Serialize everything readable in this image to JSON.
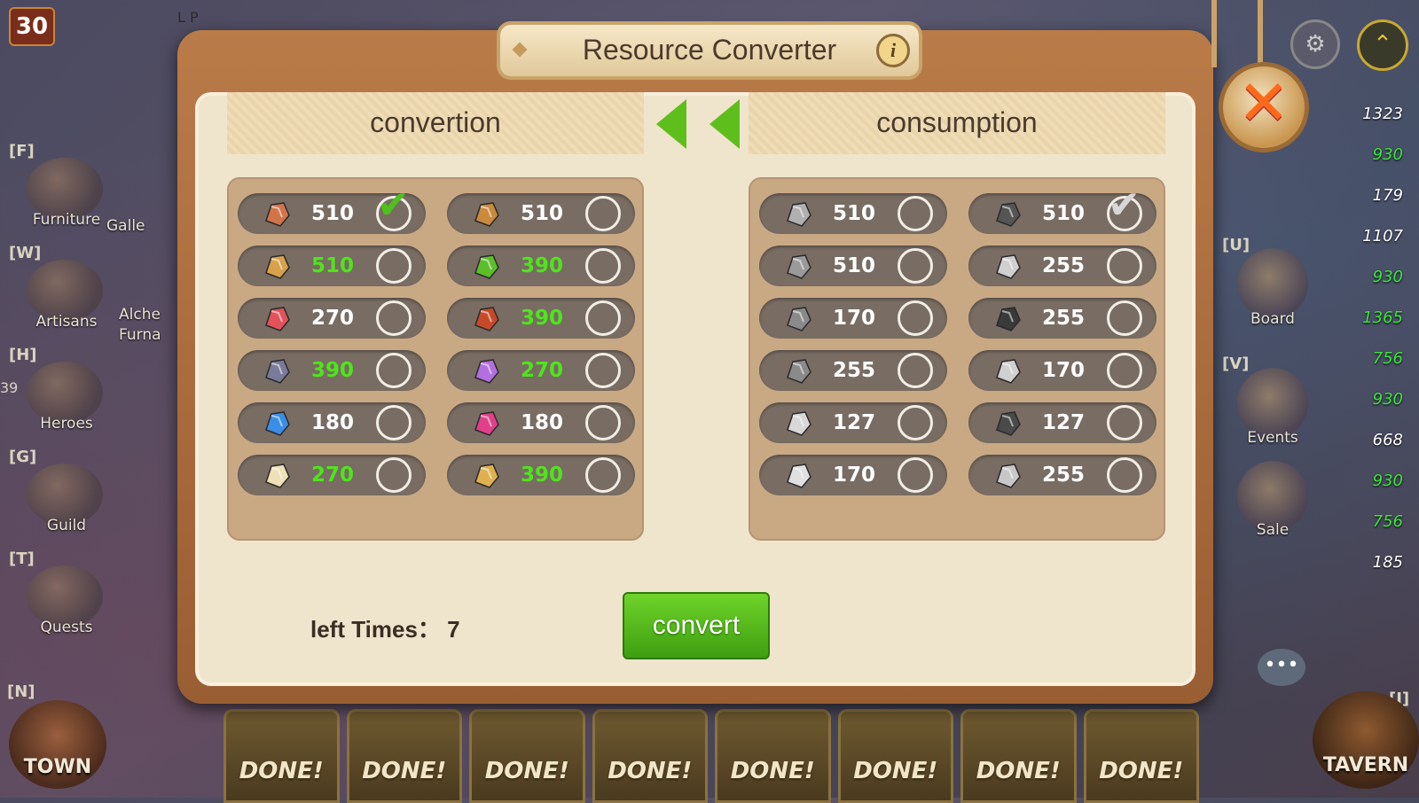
{
  "game": {
    "level": "30",
    "lp_label": "L P",
    "side_number": "39"
  },
  "left_menu": [
    {
      "key": "[F]",
      "label": "Furniture"
    },
    {
      "key": "[W]",
      "label": "Artisans"
    },
    {
      "key": "[H]",
      "label": "Heroes"
    },
    {
      "key": "[G]",
      "label": "Guild"
    },
    {
      "key": "[T]",
      "label": "Quests"
    }
  ],
  "left_menu_partial": [
    "Galle",
    "Alche",
    "Furna"
  ],
  "town": {
    "key": "[N]",
    "label": "TOWN"
  },
  "right_menu": [
    {
      "key": "[U]",
      "label": "Board"
    },
    {
      "key": "[V]",
      "label": "Events"
    },
    {
      "key": "",
      "label": "Sale"
    }
  ],
  "tavern": {
    "key": "[I]",
    "label": "TAVERN"
  },
  "resource_counts": [
    {
      "value": "1323",
      "green": false
    },
    {
      "value": "930",
      "green": true
    },
    {
      "value": "179",
      "green": false
    },
    {
      "value": "1107",
      "green": false
    },
    {
      "value": "930",
      "green": true
    },
    {
      "value": "1365",
      "green": true
    },
    {
      "value": "756",
      "green": true
    },
    {
      "value": "930",
      "green": true
    },
    {
      "value": "668",
      "green": false
    },
    {
      "value": "930",
      "green": true
    },
    {
      "value": "756",
      "green": true
    },
    {
      "value": "185",
      "green": false
    }
  ],
  "done_label": "DONE!",
  "done_count": 8,
  "dialog": {
    "title": "Resource Converter",
    "info_icon": "i",
    "close_icon": "✕",
    "conversion_header": "convertion",
    "consumption_header": "consumption",
    "left_times_label": "left Times： 7",
    "convert_label": "convert"
  },
  "conversion": [
    {
      "icon": "copper-ore-icon",
      "color": "#d2744a",
      "value": "510",
      "green": false,
      "checked": true
    },
    {
      "icon": "log-icon",
      "color": "#c98a3c",
      "value": "510",
      "green": false,
      "checked": false
    },
    {
      "icon": "parchment-icon",
      "color": "#d8a24a",
      "value": "510",
      "green": true,
      "checked": false
    },
    {
      "icon": "sprout-icon",
      "color": "#5cbf2a",
      "value": "390",
      "green": true,
      "checked": false
    },
    {
      "icon": "cloth-icon",
      "color": "#e2525a",
      "value": "270",
      "green": false,
      "checked": false
    },
    {
      "icon": "red-wood-icon",
      "color": "#c64a2a",
      "value": "390",
      "green": true,
      "checked": false
    },
    {
      "icon": "crystal-ore-icon",
      "color": "#7a7a9a",
      "value": "390",
      "green": true,
      "checked": false
    },
    {
      "icon": "flower-icon",
      "color": "#b36ee0",
      "value": "270",
      "green": true,
      "checked": false
    },
    {
      "icon": "blue-orb-icon",
      "color": "#3a8ee8",
      "value": "180",
      "green": false,
      "checked": false
    },
    {
      "icon": "pink-gem-icon",
      "color": "#e0408a",
      "value": "180",
      "green": false,
      "checked": false
    },
    {
      "icon": "scroll-icon",
      "color": "#f0e0b8",
      "value": "270",
      "green": true,
      "checked": false
    },
    {
      "icon": "fabric-roll-icon",
      "color": "#e0b050",
      "value": "390",
      "green": true,
      "checked": false
    }
  ],
  "consumption": [
    {
      "icon": "stone-icon",
      "color": "#b0b0b0",
      "value": "510",
      "checked": false
    },
    {
      "icon": "log-icon",
      "color": "#555555",
      "value": "510",
      "checked": true
    },
    {
      "icon": "parchment-icon",
      "color": "#9a9a9a",
      "value": "510",
      "checked": false
    },
    {
      "icon": "sprout-icon",
      "color": "#d0d0d0",
      "value": "255",
      "checked": false
    },
    {
      "icon": "cloth-icon",
      "color": "#8a8a8a",
      "value": "170",
      "checked": false
    },
    {
      "icon": "wood-icon",
      "color": "#3a3a3a",
      "value": "255",
      "checked": false
    },
    {
      "icon": "crystal-ore-icon",
      "color": "#8a8a8a",
      "value": "255",
      "checked": false
    },
    {
      "icon": "flower-icon",
      "color": "#d0d0d0",
      "value": "170",
      "checked": false
    },
    {
      "icon": "orb-icon",
      "color": "#d8d8d8",
      "value": "127",
      "checked": false
    },
    {
      "icon": "gem-icon",
      "color": "#4a4a4a",
      "value": "127",
      "checked": false
    },
    {
      "icon": "scroll-icon",
      "color": "#e0e0e0",
      "value": "170",
      "checked": false
    },
    {
      "icon": "fabric-roll-icon",
      "color": "#c8c8c8",
      "value": "255",
      "checked": false
    }
  ]
}
